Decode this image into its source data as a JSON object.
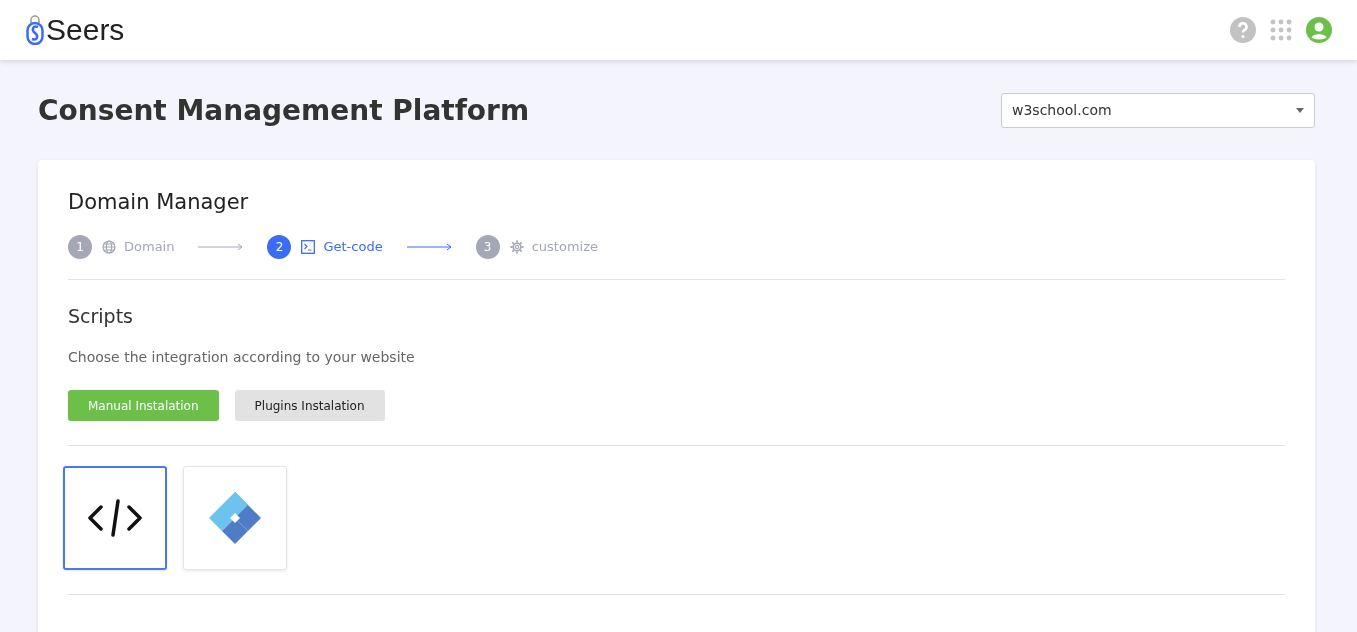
{
  "header": {
    "brand": "Seers"
  },
  "page": {
    "title": "Consent Management Platform",
    "domain_select": {
      "value": "w3school.com"
    }
  },
  "card": {
    "title": "Domain Manager",
    "steps": [
      {
        "number": "1",
        "label": "Domain",
        "kind": "globe",
        "selected": false
      },
      {
        "number": "2",
        "label": "Get-code",
        "kind": "terminal",
        "selected": true
      },
      {
        "number": "3",
        "label": "customize",
        "kind": "gear",
        "selected": false
      }
    ],
    "section_title": "Scripts",
    "description": "Choose the integration according to your website",
    "install_buttons": [
      {
        "label": "Manual Instalation",
        "selected": true
      },
      {
        "label": "Plugins Instalation",
        "selected": false
      }
    ],
    "integrations": [
      {
        "kind": "code",
        "selected": true
      },
      {
        "kind": "tag-manager",
        "selected": false
      }
    ]
  }
}
